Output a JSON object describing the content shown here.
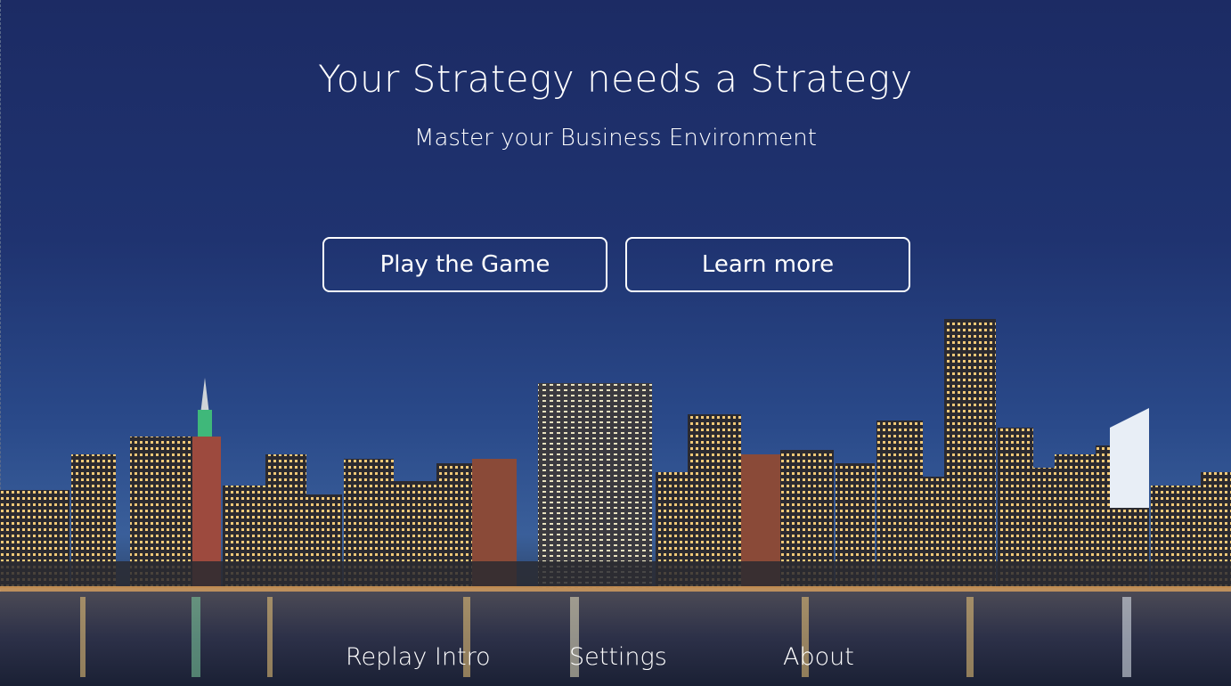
{
  "hero": {
    "title": "Your Strategy needs a Strategy",
    "subtitle": "Master your Business Environment"
  },
  "actions": {
    "play_label": "Play the Game",
    "learn_label": "Learn more"
  },
  "footer": {
    "replay_label": "Replay Intro",
    "settings_label": "Settings",
    "about_label": "About"
  },
  "colors": {
    "sky_top": "#1c2b64",
    "sky_horizon": "#3a5f9a",
    "text": "#ffffff"
  }
}
